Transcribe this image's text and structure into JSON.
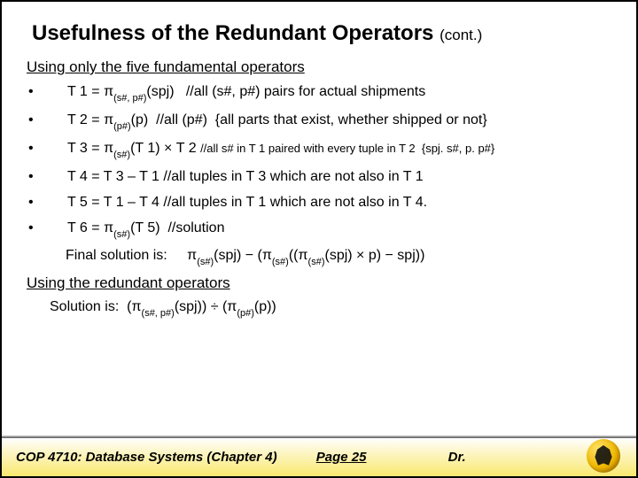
{
  "title": {
    "main": "Usefulness of the Redundant Operators",
    "cont": "(cont.)"
  },
  "sect1": "Using only the five fundamental operators",
  "rows": [
    {
      "bullet": "•",
      "html": "T 1 = π<span class='sub'>(s#, p#)</span>(spj)&nbsp;&nbsp;&nbsp;//all (s#, p#) pairs for actual shipments"
    },
    {
      "bullet": "•",
      "html": "T 2 = π<span class='sub'>(p#)</span>(p)&nbsp;&nbsp;//all (p#)&nbsp;&nbsp;{all parts that exist, whether shipped or not}"
    },
    {
      "bullet": "•",
      "html": "T 3 = π<span class='sub'>(s#)</span>(T 1) × T 2 <span class='cm'>//all s# in T 1 paired with every tuple in T 2&nbsp;&nbsp;{spj. s#, p. p#}</span>"
    },
    {
      "bullet": "•",
      "html": "T 4 = T 3 – T 1 //all tuples in T 3 which are not also in T 1"
    },
    {
      "bullet": "•",
      "html": "T 5 = T 1 – T 4 //all tuples in T 1 which are not also in T 4."
    },
    {
      "bullet": "•",
      "html": "T 6 = π<span class='sub'>(s#)</span>(T 5)&nbsp;&nbsp;//solution"
    }
  ],
  "final": {
    "lhs": "Final solution is:",
    "rhs": "π<span class='sub'>(s#)</span>(spj) − (π<span class='sub'>(s#)</span>((π<span class='sub'>(s#)</span>(spj) × p) − spj))"
  },
  "sect2": "Using the redundant operators",
  "sol": "Solution is:&nbsp;&nbsp;(π<span class='sub'>(s#, p#)</span>(spj)) ÷ (π<span class='sub'>(p#)</span>(p))",
  "footer": {
    "course": "COP 4710: Database Systems  (Chapter 4)",
    "page": "Page 25",
    "dr": "Dr."
  }
}
